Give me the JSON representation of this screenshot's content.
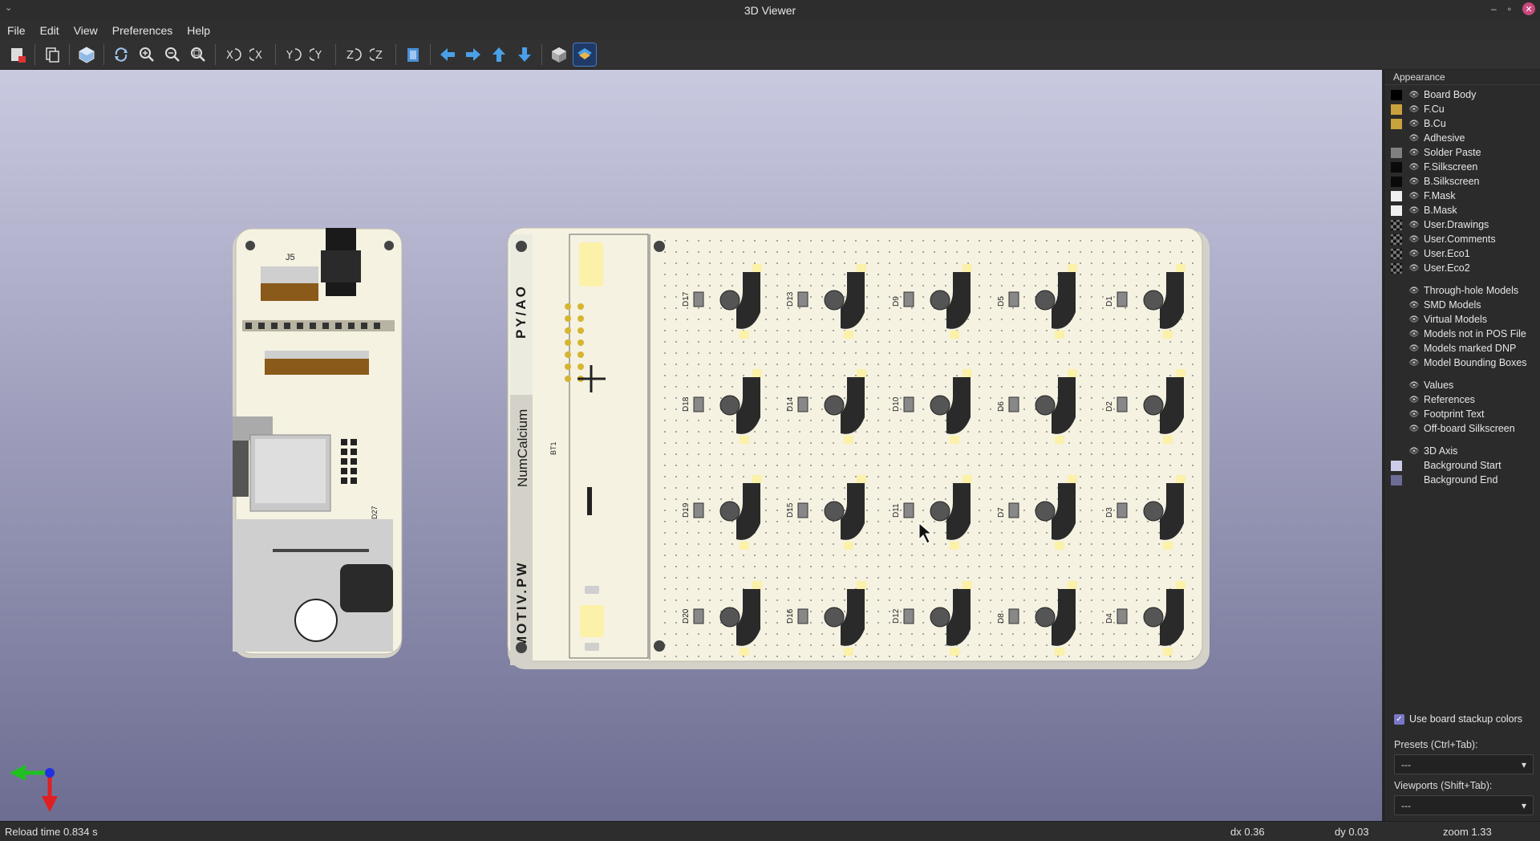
{
  "window": {
    "title": "3D Viewer"
  },
  "menu": [
    "File",
    "Edit",
    "View",
    "Preferences",
    "Help"
  ],
  "toolbar": [
    "export-icon",
    "copy-icon",
    "raytrace-icon",
    "reload-icon",
    "zoom-in-icon",
    "zoom-out-icon",
    "zoom-fit-icon",
    "rotate-x-cw-icon",
    "rotate-x-ccw-icon",
    "rotate-y-cw-icon",
    "rotate-y-ccw-icon",
    "rotate-z-cw-icon",
    "rotate-z-ccw-icon",
    "flip-board-icon",
    "move-left-icon",
    "move-right-icon",
    "move-up-icon",
    "move-down-icon",
    "ortho-icon",
    "layers-icon"
  ],
  "board_text": {
    "py_ao": "PY/AO",
    "numcalcium": "NumCalcium",
    "motiv": "MOTIV.PW",
    "j5": "J5",
    "b11": "BT1",
    "d27": "D27",
    "diodes": [
      "D17",
      "D13",
      "D9",
      "D5",
      "D1",
      "D18",
      "D14",
      "D10",
      "D6",
      "D2",
      "D19",
      "D15",
      "D11",
      "D7",
      "D3",
      "D20",
      "D16",
      "D12",
      "D8",
      "D4"
    ]
  },
  "appearance": {
    "title": "Appearance",
    "layers": [
      {
        "name": "Board Body",
        "color": "#000000"
      },
      {
        "name": "F.Cu",
        "color": "#c8a23c"
      },
      {
        "name": "B.Cu",
        "color": "#c8a23c"
      },
      {
        "name": "Adhesive",
        "color": ""
      },
      {
        "name": "Solder Paste",
        "color": "#808080"
      },
      {
        "name": "F.Silkscreen",
        "color": "#0a0a0a"
      },
      {
        "name": "B.Silkscreen",
        "color": "#0a0a0a"
      },
      {
        "name": "F.Mask",
        "color": "#f0f0f0"
      },
      {
        "name": "B.Mask",
        "color": "#f0f0f0"
      },
      {
        "name": "User.Drawings",
        "color": "checker"
      },
      {
        "name": "User.Comments",
        "color": "checker"
      },
      {
        "name": "User.Eco1",
        "color": "checker"
      },
      {
        "name": "User.Eco2",
        "color": "checker"
      }
    ],
    "objects": [
      "Through-hole Models",
      "SMD Models",
      "Virtual Models",
      "Models not in POS File",
      "Models marked DNP",
      "Model Bounding Boxes"
    ],
    "text": [
      "Values",
      "References",
      "Footprint Text",
      "Off-board Silkscreen"
    ],
    "other": [
      {
        "name": "3D Axis",
        "color": ""
      },
      {
        "name": "Background Start",
        "color": "#ccccea"
      },
      {
        "name": "Background End",
        "color": "#6c6c96"
      }
    ],
    "use_stackup": "Use board stackup colors",
    "presets_label": "Presets (Ctrl+Tab):",
    "presets_value": "---",
    "viewports_label": "Viewports (Shift+Tab):",
    "viewports_value": "---"
  },
  "status": {
    "reload": "Reload time 0.834 s",
    "dx": "dx 0.36",
    "dy": "dy 0.03",
    "zoom": "zoom 1.33"
  }
}
